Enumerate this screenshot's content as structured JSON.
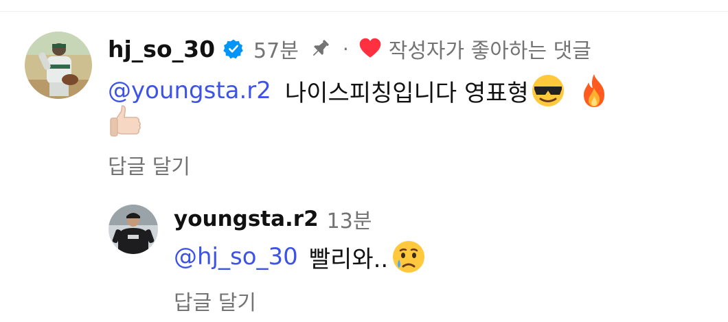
{
  "comment": {
    "username": "hj_so_30",
    "time": "57분",
    "dot": "·",
    "liked_label": "작성자가 좋아하는 댓글",
    "mention": "@youngsta.r2",
    "text": "나이스피칭입니다 영표형",
    "reply_label": "답글 달기",
    "icons": [
      "verified-badge-icon",
      "pin-icon",
      "heart-icon"
    ],
    "emojis": [
      "smiling-face-with-sunglasses",
      "fire",
      "thumbs-up"
    ]
  },
  "reply": {
    "username": "youngsta.r2",
    "time": "13분",
    "mention": "@hj_so_30",
    "text": "빨리와..",
    "reply_label": "답글 달기",
    "emojis": [
      "crying-face"
    ]
  },
  "colors": {
    "mention": "#3d53e8",
    "meta": "#737373",
    "verified": "#0095f6",
    "heart": "#ff3040"
  }
}
